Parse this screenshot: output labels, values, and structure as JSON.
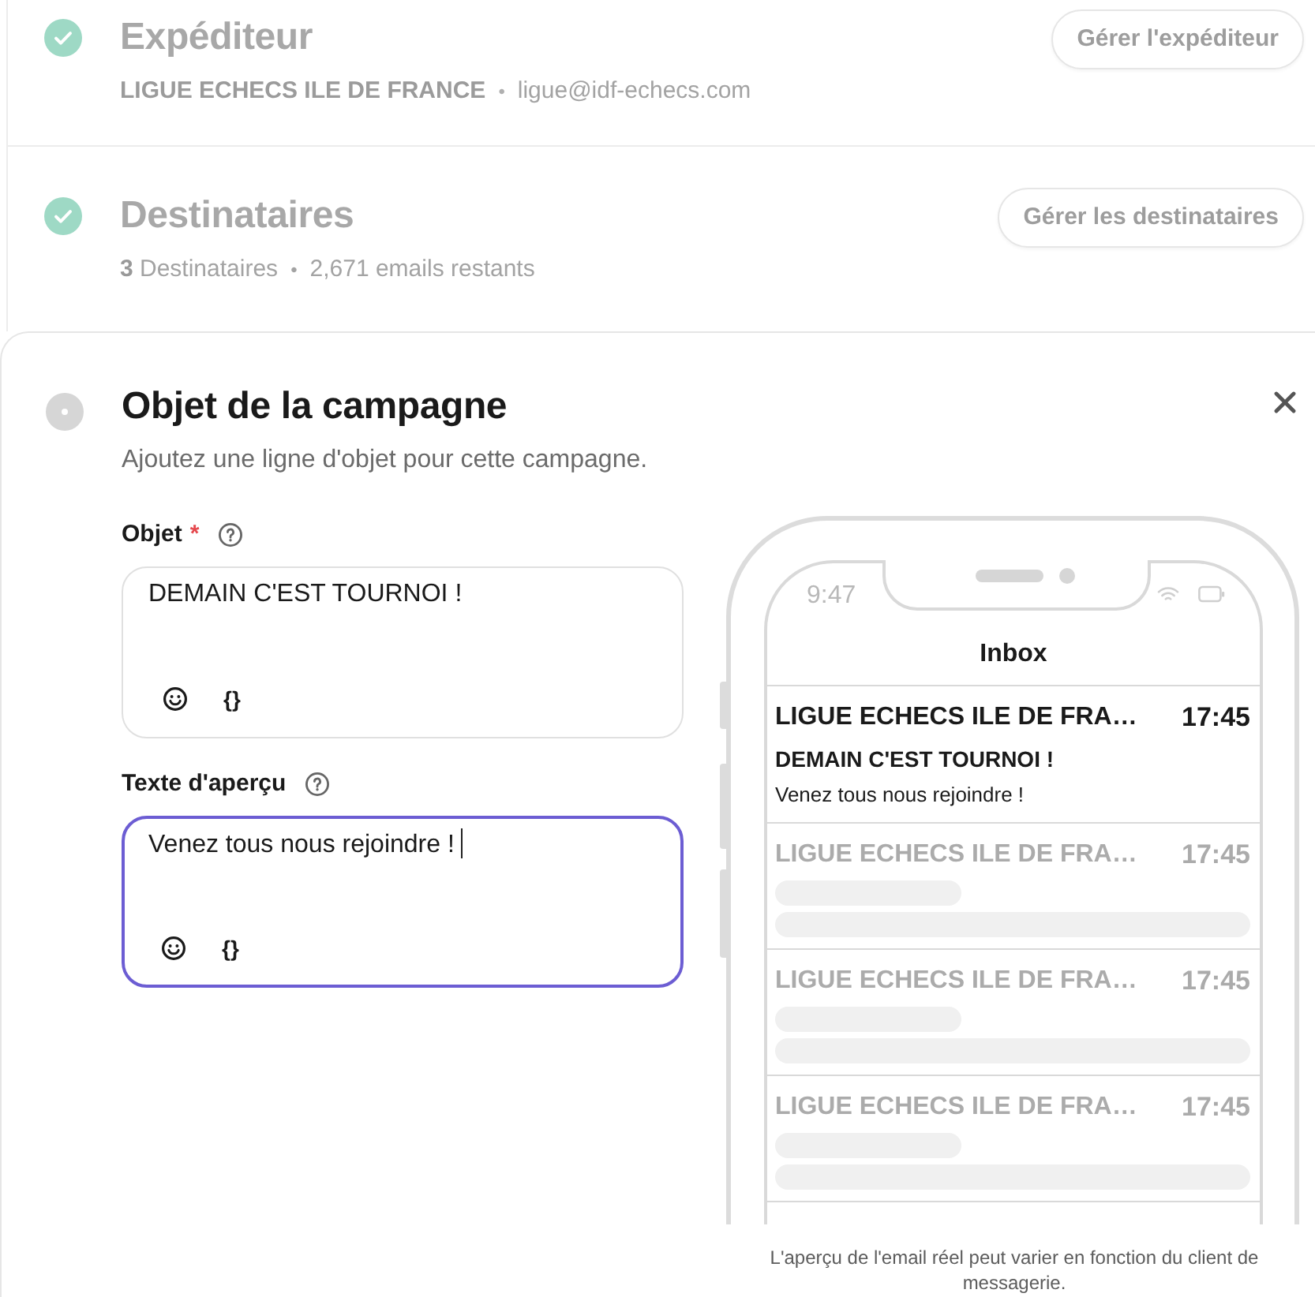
{
  "steps": [
    {
      "kind": "done",
      "title": "Expéditeur",
      "details": [
        {
          "kind": "strong",
          "text": "LIGUE ECHECS ILE DE FRANCE"
        },
        {
          "kind": "separator",
          "text": "•"
        },
        {
          "kind": "plain",
          "text": "ligue@idf-echecs.com"
        }
      ],
      "button": "Gérer l'expéditeur"
    },
    {
      "kind": "done",
      "title": "Destinataires",
      "details": [
        {
          "kind": "plain",
          "text": "**3** Destinataires"
        },
        {
          "kind": "bullet",
          "text": "•"
        },
        {
          "kind": "plain",
          "text": "2,671 emails restants"
        }
      ],
      "button": "Gérer les destinataires"
    }
  ],
  "current_step": {
    "kind": "active",
    "title": "Objet de la campagne",
    "description": "Ajoutez une ligne d'objet pour cette campagne.",
    "fields": [
      {
        "label": "Objet",
        "required_mark": "*",
        "value": "DEMAIN C'EST TOURNOI !",
        "focused": false,
        "variables": "{}"
      },
      {
        "label": "Texte d'aperçu",
        "value": "Venez tous nous rejoindre !",
        "focused": true,
        "variables": "{}"
      }
    ],
    "phone": {
      "time": "9:47",
      "header": "Inbox",
      "emails": [
        {
          "kind": "full",
          "sender": "LIGUE ECHECS ILE DE FRA…",
          "time": "17:45",
          "subject": "DEMAIN C'EST TOURNOI !",
          "preview": "Venez tous nous rejoindre !"
        },
        {
          "kind": "placeholder",
          "sender": "LIGUE ECHECS ILE DE FRA…",
          "time": "17:45"
        },
        {
          "kind": "placeholder",
          "sender": "LIGUE ECHECS ILE DE FRA…",
          "time": "17:45"
        },
        {
          "kind": "placeholder",
          "sender": "LIGUE ECHECS ILE DE FRA…",
          "time": "17:45"
        }
      ]
    },
    "disclaimer": "L'aperçu de l'email réel peut varier en fonction du client de messagerie."
  }
}
